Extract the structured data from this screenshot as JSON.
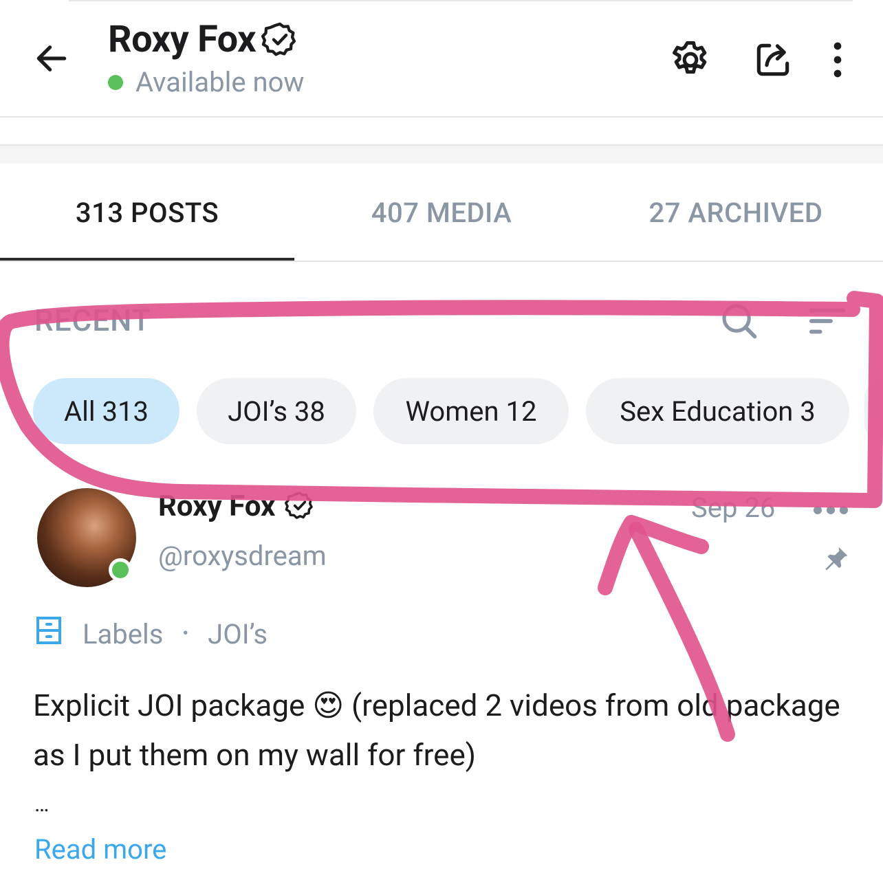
{
  "header": {
    "title": "Roxy Fox",
    "status_text": "Available now",
    "status_color": "#5ac15a",
    "icons": [
      "back-arrow-icon",
      "verified-icon",
      "gear-icon",
      "share-icon",
      "more-vertical-icon"
    ]
  },
  "tabs": [
    {
      "label": "313 POSTS",
      "active": true
    },
    {
      "label": "407 MEDIA",
      "active": false
    },
    {
      "label": "27 ARCHIVED",
      "active": false
    }
  ],
  "section": {
    "title": "RECENT",
    "icons": [
      "search-icon",
      "sort-icon"
    ]
  },
  "chips": [
    {
      "label": "All 313",
      "active": true
    },
    {
      "label": "JOI’s 38",
      "active": false
    },
    {
      "label": "Women 12",
      "active": false
    },
    {
      "label": "Sex Education 3",
      "active": false
    }
  ],
  "post": {
    "author_name": "Roxy Fox",
    "handle": "@roxysdream",
    "date": "Sep 26",
    "labels_title": "Labels",
    "label_value": "JOI’s",
    "text": "Explicit JOI package 😍 (replaced 2 videos from old package as I put them on my wall for free)",
    "ellipsis": "…",
    "read_more": "Read more"
  },
  "colors": {
    "accent_blue": "#3aa8ea",
    "chip_active_bg": "#cbe9fb",
    "chip_bg": "#f0f1f3",
    "muted_text": "#8a96a3",
    "annotation_pink": "#e0528c"
  }
}
